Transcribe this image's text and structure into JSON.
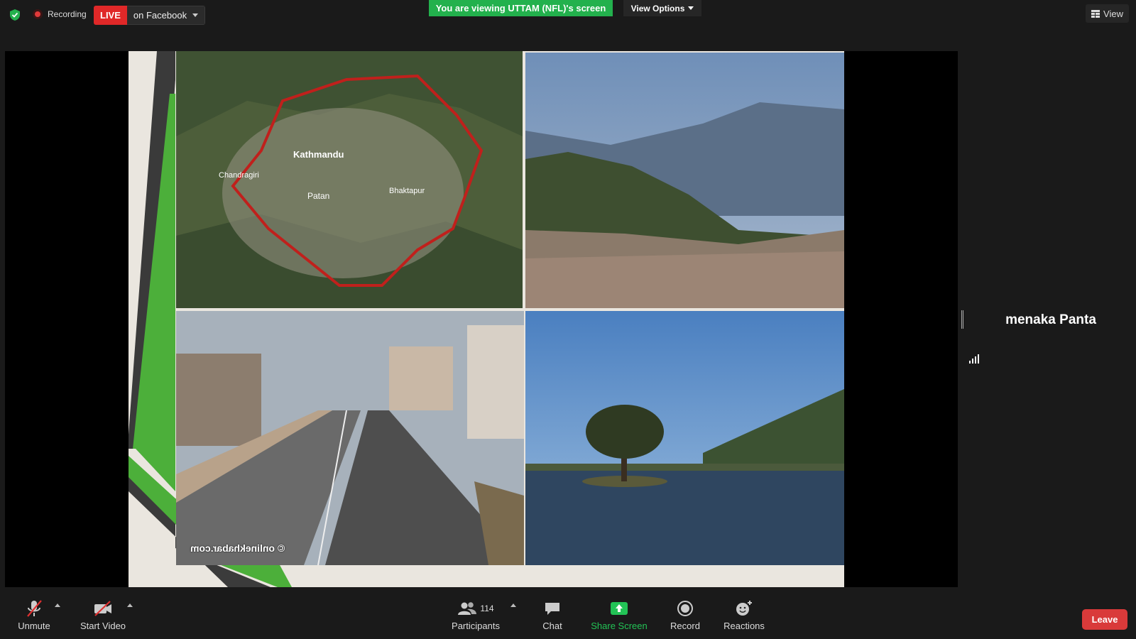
{
  "top_bar": {
    "security_icon": "shield-check-icon",
    "recording_label": "Recording",
    "live_badge": "LIVE",
    "live_destination": "on Facebook",
    "viewing_banner": "You are viewing UTTAM (NFL)'s screen",
    "view_options_label": "View Options",
    "view_label": "View",
    "colors": {
      "viewing_banner": "#23b14d",
      "live_badge": "#e02828"
    }
  },
  "shared_content": {
    "watermark": "© onlinekhabar.com",
    "images": [
      "kathmandu-valley-map",
      "kathmandu-city-hills",
      "ring-road",
      "lake-with-tree"
    ]
  },
  "participant": {
    "name": "menaka Panta",
    "signal_icon": "signal-bars-icon"
  },
  "toolbar": {
    "unmute_label": "Unmute",
    "start_video_label": "Start Video",
    "participants_label": "Participants",
    "participants_count": "114",
    "chat_label": "Chat",
    "share_screen_label": "Share Screen",
    "record_label": "Record",
    "reactions_label": "Reactions",
    "leave_label": "Leave",
    "colors": {
      "share_screen": "#23c356",
      "leave": "#d93a3a"
    }
  }
}
